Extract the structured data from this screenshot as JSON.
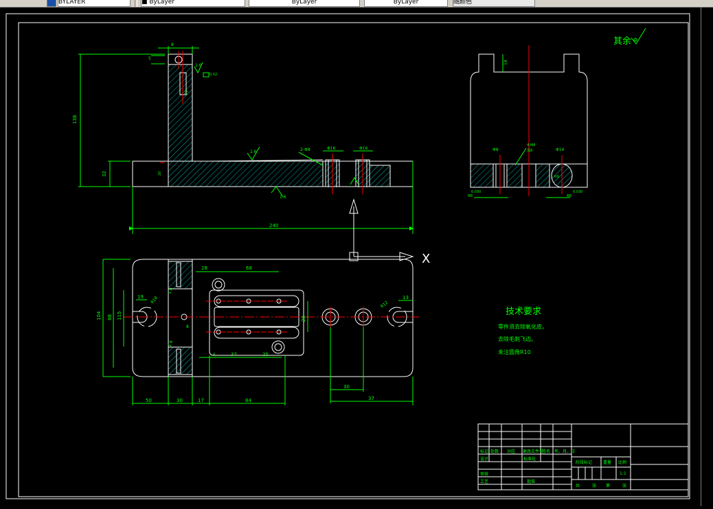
{
  "toolbar": {
    "layer_value": "BYLAYER",
    "color_value": "ByLayer",
    "linetype_value": "ByLayer",
    "lineweight_value": "ByLayer",
    "plotstyle_value": "随颜色"
  },
  "drawing": {
    "surface_mark": "其余",
    "ucs_x_label": "X",
    "tech_title": "技术要求",
    "tech_lines": [
      "零件须去除氧化皮。",
      "去除毛刺飞边。",
      "未注圆角R10"
    ],
    "dims": {
      "overall_length": "240",
      "height": "138",
      "base_h": "32",
      "top_w": "8",
      "top_5": "5",
      "ra16_a": "1.6",
      "ra16_b": "1.6",
      "ra16_c": "1.6",
      "ra16_d": "1.6",
      "ra16_e": "1.6",
      "tol_a": "0.02",
      "rib_h": "17",
      "web_20": "20",
      "hole_note": "2-Φ8",
      "phi16_a": "Φ16",
      "phi16_b": "Φ16",
      "dim_28": "28",
      "dim_68": "68",
      "dim_23": "23",
      "dim_115": "115",
      "dim_88": "88",
      "dim_104": "104",
      "dim_19": "19",
      "r18_a": "R18",
      "r12": "R12",
      "dim_13": "13",
      "dim_6": "6",
      "dim_8": "8",
      "dim_37": "37",
      "dim_25": "25",
      "dim_30": "30",
      "dim_37b": "37",
      "b_50": "50",
      "b_30": "30",
      "b_17": "17",
      "b_84": "84",
      "side_14": "14",
      "side_phi8": "Φ8",
      "side_hole": "4-M8",
      "side_depth": "深8",
      "side_phi14": "Φ14",
      "side_r": "R9",
      "side_tol1": "0.030",
      "side_tol2": "0.030",
      "side_a": "Φ8",
      "side_b": "Φ8"
    }
  },
  "title_block": {
    "row_labels": [
      "标记",
      "处数",
      "分区",
      "更改文件号",
      "签名",
      "年、月、日"
    ],
    "design": "设计",
    "standard": "标准化",
    "review": "审核",
    "process": "工艺",
    "approve": "批准",
    "stage_mark": "阶段标记",
    "weight": "重量",
    "scale": "比例",
    "scale_value": "1:1",
    "total": "共",
    "sheet": "张",
    "page": "第",
    "page2": "张"
  }
}
